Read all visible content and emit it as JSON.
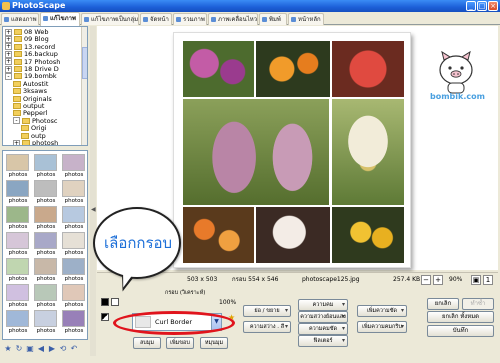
{
  "window": {
    "title": "PhotoScape",
    "minimize": "_",
    "maximize": "□",
    "close": "×"
  },
  "tabs": [
    {
      "label": "แสดงภาพ",
      "active": false
    },
    {
      "label": "แก้ไขภาพ",
      "active": true
    },
    {
      "label": "แก้ไขภาพเป็นกลุ่ม",
      "active": false
    },
    {
      "label": "จัดหน้า",
      "active": false
    },
    {
      "label": "รวมภาพ",
      "active": false
    },
    {
      "label": "ภาพเคลื่อนไหว",
      "active": false
    },
    {
      "label": "พิมพ์",
      "active": false
    },
    {
      "label": "หน้าหลัก",
      "active": false
    }
  ],
  "tree": [
    {
      "label": "08 Web",
      "level": 1,
      "exp": "+"
    },
    {
      "label": "09 Blog",
      "level": 1,
      "exp": "+"
    },
    {
      "label": "13.record",
      "level": 1,
      "exp": "+"
    },
    {
      "label": "16.backup",
      "level": 1,
      "exp": "+"
    },
    {
      "label": "17 Photosh",
      "level": 1,
      "exp": "+"
    },
    {
      "label": "18 Drive D",
      "level": 1,
      "exp": "+"
    },
    {
      "label": "19.bombk",
      "level": 1,
      "exp": "-"
    },
    {
      "label": "Autostit",
      "level": 2,
      "exp": ""
    },
    {
      "label": "3ksaws",
      "level": 2,
      "exp": ""
    },
    {
      "label": "Originals",
      "level": 2,
      "exp": ""
    },
    {
      "label": "output",
      "level": 2,
      "exp": ""
    },
    {
      "label": "Pepperl",
      "level": 2,
      "exp": ""
    },
    {
      "label": "Photosc",
      "level": 2,
      "exp": "-"
    },
    {
      "label": "Origi",
      "level": 3,
      "exp": ""
    },
    {
      "label": "outp",
      "level": 3,
      "exp": ""
    },
    {
      "label": "photosh",
      "level": 2,
      "exp": "+"
    }
  ],
  "thumb_labels": [
    "photos",
    "photos",
    "photos",
    "photos",
    "photos",
    "photos",
    "photos",
    "photos",
    "photos",
    "photos",
    "photos",
    "photos",
    "photos",
    "photos",
    "photos",
    "photos",
    "photos",
    "photos",
    "photos",
    "photos",
    "photos"
  ],
  "mascot_text": "bombik.com",
  "status": {
    "dims": "503 x 503",
    "frame": "กรอบ 554 x 546",
    "file": "photoscape125.jpg",
    "size": "257.4 KB",
    "zoom": "90%"
  },
  "toolbar": {
    "frame_label": "กรอบ (วิเคราะห์)",
    "percent": "100%",
    "frame_combo": "Curl Border",
    "btn_save_left": "ลบมุม",
    "btn_margin": "เพิ่มขอบ",
    "btn_round": "หมุนมุม",
    "btn_crop": "ย่อ / ขยาย",
    "btn_bright": "ความสว่าง . สี",
    "btn_sharp": "ความคม",
    "btn_backlight": "ความสว่าง",
    "btn_bright2": "ความสว่างย้อนแสง",
    "btn_contrast": "ความคมชัด",
    "btn_filter": "ฟิลเตอร์",
    "btn_sharpen1": "เพิ่มความชัด",
    "btn_sharpen2": "เพิ่มความคมกริบ",
    "btn_contrast2": "ความคมชัด",
    "undo": "ยกเลิก",
    "redo": "ทำซ้ำ",
    "undo_all": "ยกเลิก ทั้งหมด",
    "save": "บันทึก"
  },
  "callout": {
    "text": "เลือกกรอบ"
  },
  "colors": {
    "accent": "#1d6fd8",
    "highlight": "#e0141c",
    "title_bar": "#1c5fd8"
  }
}
